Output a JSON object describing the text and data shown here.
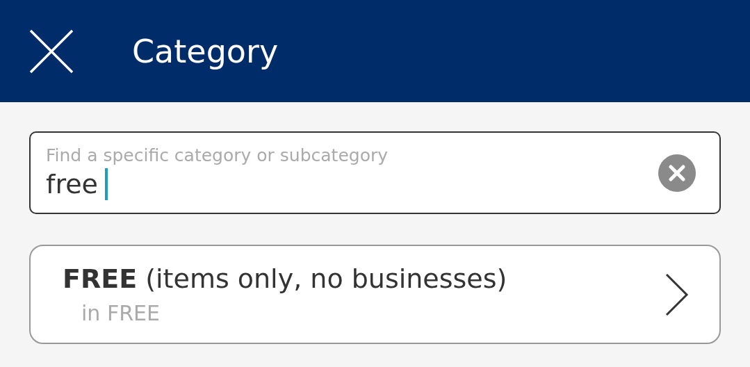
{
  "header": {
    "title": "Category"
  },
  "search": {
    "label": "Find a specific category or subcategory",
    "value": "free",
    "focused": true
  },
  "results": [
    {
      "title": "**FREE** (items only, no businesses)",
      "subtitle": "in FREE"
    }
  ]
}
